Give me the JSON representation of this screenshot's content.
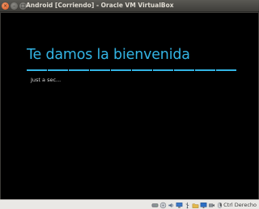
{
  "window": {
    "title": "Android [Corriendo] - Oracle VM VirtualBox",
    "close_glyph": "×",
    "minimize_glyph": "–",
    "maximize_glyph": "□"
  },
  "guest": {
    "welcome_title": "Te damos la bienvenida",
    "status_message": "Just a sec...",
    "accent_color": "#33b5e5",
    "background_color": "#000000"
  },
  "statusbar": {
    "icons": [
      "hard-disk-icon",
      "optical-drive-icon",
      "audio-icon",
      "network-icon",
      "usb-icon",
      "shared-folders-icon",
      "display-icon",
      "video-capture-icon",
      "mouse-integration-icon"
    ],
    "host_key_label": "Ctrl Derecho",
    "host_key_arrow": "⬇"
  }
}
